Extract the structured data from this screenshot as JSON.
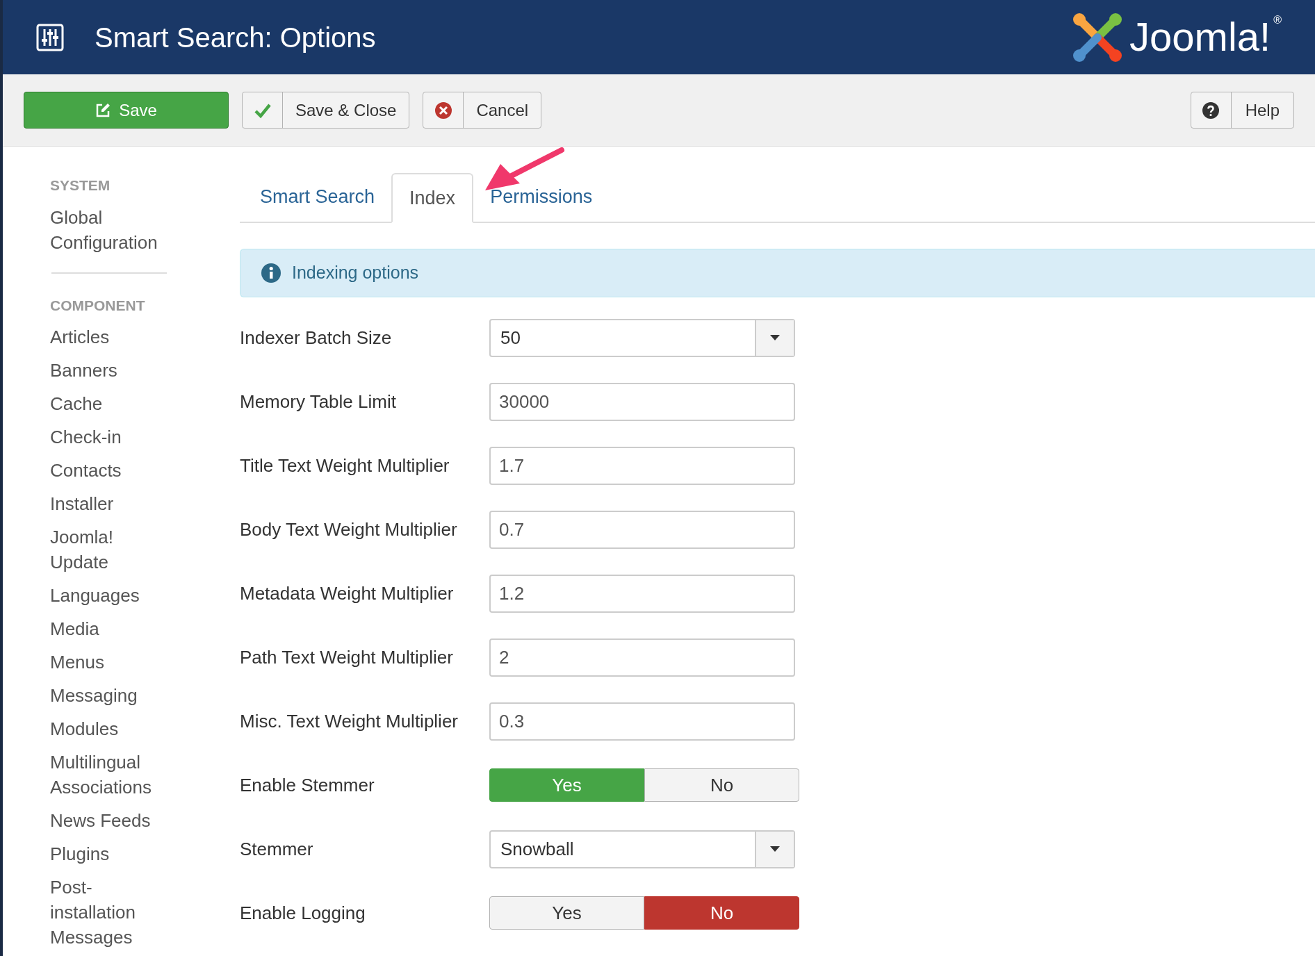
{
  "header": {
    "title": "Smart Search: Options",
    "logo_text": "Joomla!",
    "logo_mark": "®"
  },
  "toolbar": {
    "buttons": [
      {
        "label": "Save",
        "kind": "primary"
      },
      {
        "label": "Save & Close",
        "kind": "check"
      },
      {
        "label": "Cancel",
        "kind": "cancel"
      }
    ],
    "help": "Help"
  },
  "sidebar": {
    "sections": [
      {
        "heading": "SYSTEM",
        "items": [
          "Global Configuration"
        ]
      },
      {
        "heading": "COMPONENT",
        "items": [
          "Articles",
          "Banners",
          "Cache",
          "Check-in",
          "Contacts",
          "Installer",
          "Joomla! Update",
          "Languages",
          "Media",
          "Menus",
          "Messaging",
          "Modules",
          "Multilingual Associations",
          "News Feeds",
          "Plugins",
          "Post-installation Messages"
        ]
      }
    ]
  },
  "tabs": [
    {
      "label": "Smart Search",
      "selected": false
    },
    {
      "label": "Index",
      "selected": true
    },
    {
      "label": "Permissions",
      "selected": false
    }
  ],
  "alert": "Indexing options",
  "fields": [
    {
      "label": "Indexer Batch Size",
      "kind": "select",
      "value": "50"
    },
    {
      "label": "Memory Table Limit",
      "kind": "text",
      "value": "30000"
    },
    {
      "label": "Title Text Weight Multiplier",
      "kind": "text",
      "value": "1.7"
    },
    {
      "label": "Body Text Weight Multiplier",
      "kind": "text",
      "value": "0.7"
    },
    {
      "label": "Metadata Weight Multiplier",
      "kind": "text",
      "value": "1.2"
    },
    {
      "label": "Path Text Weight Multiplier",
      "kind": "text",
      "value": "2"
    },
    {
      "label": "Misc. Text Weight Multiplier",
      "kind": "text",
      "value": "0.3"
    },
    {
      "label": "Enable Stemmer",
      "kind": "toggle",
      "options": [
        {
          "label": "Yes",
          "selected": true,
          "kind": "yes"
        },
        {
          "label": "No",
          "selected": false,
          "kind": "no"
        }
      ]
    },
    {
      "label": "Stemmer",
      "kind": "select",
      "value": "Snowball"
    },
    {
      "label": "Enable Logging",
      "kind": "toggle",
      "options": [
        {
          "label": "Yes",
          "selected": false,
          "kind": "yes"
        },
        {
          "label": "No",
          "selected": true,
          "kind": "no"
        }
      ]
    }
  ]
}
